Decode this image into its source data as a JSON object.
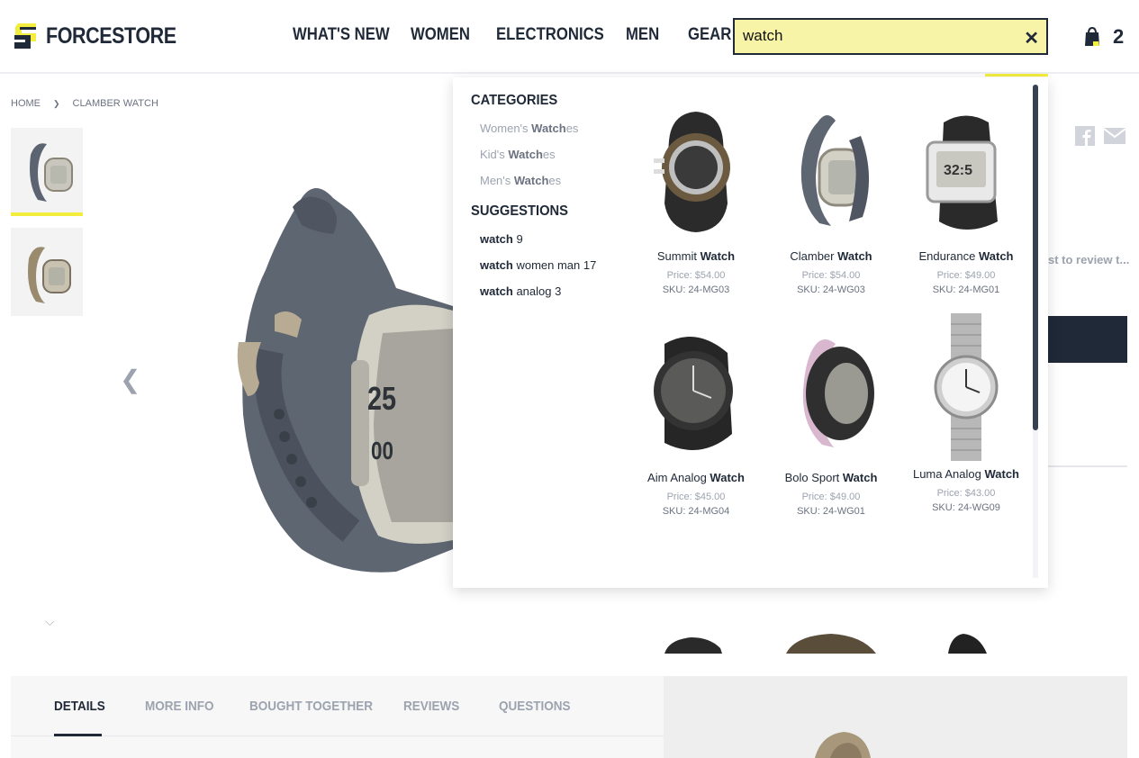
{
  "brand": {
    "name": "FORCESTORE",
    "accent": "#f3ee3d",
    "dark": "#1f2937"
  },
  "nav": {
    "items": [
      "WHAT'S NEW",
      "WOMEN",
      "ELECTRONICS",
      "MEN",
      "GEAR"
    ]
  },
  "search": {
    "value": "watch",
    "clear_label": "✕"
  },
  "cart": {
    "count": "2",
    "icon": "shopping-bag-icon"
  },
  "breadcrumb": {
    "home": "HOME",
    "separator": "❯",
    "current": "CLAMBER WATCH"
  },
  "gallery": {
    "prev_label": "❮",
    "down_label": "⌵"
  },
  "product_side": {
    "review_link": "st to review t..."
  },
  "dropdown": {
    "categories_heading": "CATEGORIES",
    "categories": [
      {
        "pre": "Women's ",
        "match": "Watch",
        "post": "es"
      },
      {
        "pre": "Kid's ",
        "match": "Watch",
        "post": "es"
      },
      {
        "pre": "Men's ",
        "match": "Watch",
        "post": "es"
      }
    ],
    "suggestions_heading": "SUGGESTIONS",
    "suggestions": [
      {
        "match": "watch",
        "rest": " 9"
      },
      {
        "match": "watch",
        "rest": " women man 17"
      },
      {
        "match": "watch",
        "rest": " analog 3"
      }
    ],
    "products": [
      {
        "pre": "Summit ",
        "match": "Watch",
        "price": "Price: $54.00",
        "sku": "SKU: 24-MG03"
      },
      {
        "pre": "Clamber ",
        "match": "Watch",
        "price": "Price: $54.00",
        "sku": "SKU: 24-WG03"
      },
      {
        "pre": "Endurance ",
        "match": "Watch",
        "price": "Price: $49.00",
        "sku": "SKU: 24-MG01"
      },
      {
        "pre": "Aim Analog ",
        "match": "Watch",
        "price": "Price: $45.00",
        "sku": "SKU: 24-MG04"
      },
      {
        "pre": "Bolo Sport ",
        "match": "Watch",
        "price": "Price: $49.00",
        "sku": "SKU: 24-WG01"
      },
      {
        "pre": "Luma Analog ",
        "match": "Watch",
        "price": "Price: $43.00",
        "sku": "SKU: 24-WG09"
      }
    ]
  },
  "tabs": [
    "DETAILS",
    "MORE INFO",
    "BOUGHT TOGETHER",
    "REVIEWS",
    "QUESTIONS"
  ]
}
